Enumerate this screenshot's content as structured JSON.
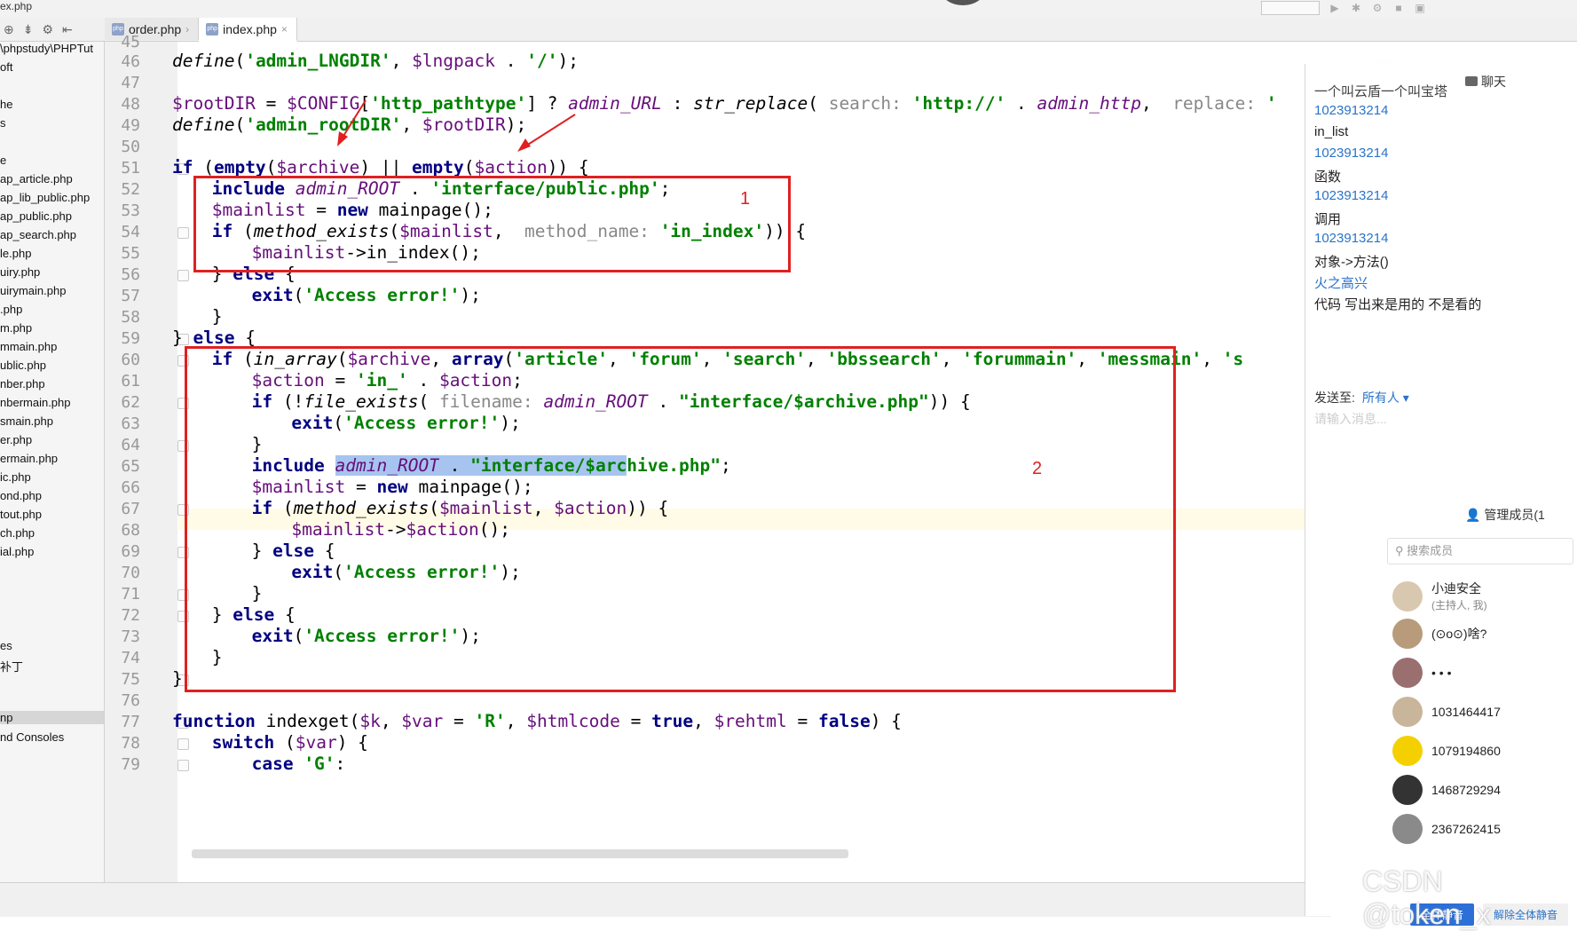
{
  "window": {
    "breadcrumb": "ex.php",
    "tabs": [
      {
        "label": "order.php",
        "active": false
      },
      {
        "label": "index.php",
        "active": true
      }
    ]
  },
  "project_panel": {
    "items": [
      {
        "label": "\\phpstudy\\PHPTut",
        "y": 0
      },
      {
        "label": "oft",
        "y": 1
      },
      {
        "label": "he",
        "y": 3
      },
      {
        "label": "s",
        "y": 4
      },
      {
        "label": "e",
        "y": 6
      },
      {
        "label": "ap_article.php",
        "y": 7
      },
      {
        "label": "ap_lib_public.php",
        "y": 8
      },
      {
        "label": "ap_public.php",
        "y": 9
      },
      {
        "label": "ap_search.php",
        "y": 10
      },
      {
        "label": "le.php",
        "y": 11
      },
      {
        "label": "uiry.php",
        "y": 12
      },
      {
        "label": "uirymain.php",
        "y": 13
      },
      {
        "label": ".php",
        "y": 14
      },
      {
        "label": "m.php",
        "y": 15
      },
      {
        "label": "mmain.php",
        "y": 16
      },
      {
        "label": "ublic.php",
        "y": 17
      },
      {
        "label": "nber.php",
        "y": 18
      },
      {
        "label": "nbermain.php",
        "y": 19
      },
      {
        "label": "smain.php",
        "y": 20
      },
      {
        "label": "er.php",
        "y": 21
      },
      {
        "label": "ermain.php",
        "y": 22
      },
      {
        "label": "ic.php",
        "y": 23
      },
      {
        "label": "ond.php",
        "y": 24
      },
      {
        "label": "tout.php",
        "y": 25
      },
      {
        "label": "ch.php",
        "y": 26
      },
      {
        "label": "ial.php",
        "y": 27
      }
    ],
    "lower_items": [
      "es",
      "补丁"
    ],
    "selected_item": "np",
    "consoles_item": "nd Consoles"
  },
  "editor": {
    "line_numbers": [
      "45",
      "46",
      "47",
      "48",
      "49",
      "50",
      "51",
      "52",
      "53",
      "54",
      "55",
      "56",
      "57",
      "58",
      "59",
      "60",
      "61",
      "62",
      "63",
      "64",
      "65",
      "66",
      "67",
      "68",
      "69",
      "70",
      "71",
      "72",
      "73",
      "74",
      "75",
      "76",
      "77",
      "78",
      "79"
    ],
    "code": {
      "l46": {
        "a": "define",
        "b": "(",
        "c": "'admin_LNGDIR'",
        "d": ", ",
        "e": "$lngpack",
        "f": " . ",
        "g": "'/'",
        "h": ");"
      },
      "l48": {
        "a": "$rootDIR",
        "b": " = ",
        "c": "$CONFIG",
        "d": "[",
        "e": "'http_pathtype'",
        "f": "] ? ",
        "g": "admin_URL",
        "h": " : ",
        "i": "str_replace",
        "j": "( ",
        "k": "search:",
        "l": " ",
        "m": "'http://'",
        "n": " . ",
        "o": "admin_http",
        "p": ",  ",
        "q": "replace:",
        "r": " '"
      },
      "l49": {
        "a": "define",
        "b": "(",
        "c": "'admin_rootDIR'",
        "d": ", ",
        "e": "$rootDIR",
        "f": ");"
      },
      "l51": {
        "a": "if",
        "b": " (",
        "c": "empty",
        "d": "(",
        "e": "$archive",
        "f": ") || ",
        "g": "empty",
        "h": "(",
        "i": "$action",
        "j": ")) {"
      },
      "l52": {
        "a": "include",
        "b": " ",
        "c": "admin_ROOT",
        "d": " . ",
        "e": "'interface/public.php'",
        "f": ";"
      },
      "l53": {
        "a": "$mainlist",
        "b": " = ",
        "c": "new",
        "d": " mainpage();"
      },
      "l54": {
        "a": "if",
        "b": " (",
        "c": "method_exists",
        "d": "(",
        "e": "$mainlist",
        "f": ",  ",
        "g": "method_name:",
        "h": " ",
        "i": "'in_index'",
        "j": ")) {"
      },
      "l55": {
        "a": "$mainlist",
        "b": "->in_index();"
      },
      "l56": {
        "a": "} ",
        "b": "else",
        "c": " {"
      },
      "l57": {
        "a": "exit",
        "b": "(",
        "c": "'Access error!'",
        "d": ");"
      },
      "l58": {
        "a": "}"
      },
      "l59": {
        "a": "} ",
        "b": "else",
        "c": " {"
      },
      "l60": {
        "a": "if",
        "b": " (",
        "c": "in_array",
        "d": "(",
        "e": "$archive",
        "f": ", ",
        "g": "array",
        "h": "(",
        "i": "'article'",
        "j": ", ",
        "k": "'forum'",
        "l": ", ",
        "m": "'search'",
        "n": ", ",
        "o": "'bbssearch'",
        "p": ", ",
        "q": "'forummain'",
        "r": ", ",
        "s": "'messmain'",
        "t": ", ",
        "u": "'s"
      },
      "l61": {
        "a": "$action",
        "b": " = ",
        "c": "'in_'",
        "d": " . ",
        "e": "$action",
        "f": ";"
      },
      "l62": {
        "a": "if",
        "b": " (!",
        "c": "file_exists",
        "d": "( ",
        "e": "filename:",
        "f": " ",
        "g": "admin_ROOT",
        "h": " . ",
        "i": "\"interface/$archive.php\"",
        "j": ")) {"
      },
      "l63": {
        "a": "exit",
        "b": "(",
        "c": "'Access error!'",
        "d": ");"
      },
      "l64": {
        "a": "}"
      },
      "l65": {
        "a": "include",
        "b": " ",
        "c": "admin_ROOT",
        "d": " . ",
        "e": "\"interface/$arc",
        "f": "hive.php\"",
        "g": ";"
      },
      "l66": {
        "a": "$mainlist",
        "b": " = ",
        "c": "new",
        "d": " mainpage();"
      },
      "l67": {
        "a": "if",
        "b": " (",
        "c": "method_exists",
        "d": "(",
        "e": "$mainlist",
        "f": ", ",
        "g": "$action",
        "h": ")) {"
      },
      "l68": {
        "a": "$mainlist",
        "b": "->",
        "c": "$action",
        "d": "();"
      },
      "l69": {
        "a": "} ",
        "b": "else",
        "c": " {"
      },
      "l70": {
        "a": "exit",
        "b": "(",
        "c": "'Access error!'",
        "d": ");"
      },
      "l71": {
        "a": "}"
      },
      "l72": {
        "a": "} ",
        "b": "else",
        "c": " {"
      },
      "l73": {
        "a": "exit",
        "b": "(",
        "c": "'Access error!'",
        "d": ");"
      },
      "l74": {
        "a": "}"
      },
      "l75": {
        "a": "}"
      },
      "l77": {
        "a": "function",
        "b": " indexget(",
        "c": "$k",
        "d": ", ",
        "e": "$var",
        "f": " = ",
        "g": "'R'",
        "h": ", ",
        "i": "$htmlcode",
        "j": " = ",
        "k": "true",
        "l": ", ",
        "m": "$rehtml",
        "n": " = ",
        "o": "false",
        "p": ") {"
      },
      "l78": {
        "a": "switch",
        "b": " (",
        "c": "$var",
        "d": ") {"
      },
      "l79": {
        "a": "case",
        "b": " ",
        "c": "'G'",
        "d": ":"
      }
    },
    "annotations": {
      "box1_label": "1",
      "box2_label": "2"
    }
  },
  "chat": {
    "title": "聊天",
    "messages": [
      {
        "kind": "text",
        "text": "一个叫云盾一个叫宝塔"
      },
      {
        "kind": "name",
        "text": "1023913214"
      },
      {
        "kind": "text",
        "text": "in_list"
      },
      {
        "kind": "name",
        "text": "1023913214"
      },
      {
        "kind": "text",
        "text": "函数"
      },
      {
        "kind": "name",
        "text": "1023913214"
      },
      {
        "kind": "text",
        "text": "调用"
      },
      {
        "kind": "name",
        "text": "1023913214"
      },
      {
        "kind": "text",
        "text": "对象->方法()"
      },
      {
        "kind": "name",
        "text": "火之高兴"
      },
      {
        "kind": "text",
        "text": "代码 写出来是用的 不是看的"
      }
    ],
    "send_to_label": "发送至:",
    "send_to_target": "所有人",
    "input_placeholder": "请输入消息...",
    "members_header": "管理成员(1",
    "member_search_placeholder": "搜索成员",
    "members": [
      {
        "name": "小迪安全",
        "sub": "(主持人, 我)"
      },
      {
        "name": "(⊙o⊙)啥?",
        "sub": ""
      },
      {
        "name": "• • •",
        "sub": ""
      },
      {
        "name": "1031464417",
        "sub": ""
      },
      {
        "name": "1079194860",
        "sub": ""
      },
      {
        "name": "1468729294",
        "sub": ""
      },
      {
        "name": "2367262415",
        "sub": ""
      }
    ],
    "buttons": {
      "mute_all": "全体静音",
      "unmute_all": "解除全体静音"
    }
  },
  "watermark": "CSDN @token_x",
  "colors": {
    "keyword": "#000080",
    "string": "#008000",
    "variable": "#660e7a",
    "annotation": "#e02020",
    "link": "#2a73c9"
  }
}
